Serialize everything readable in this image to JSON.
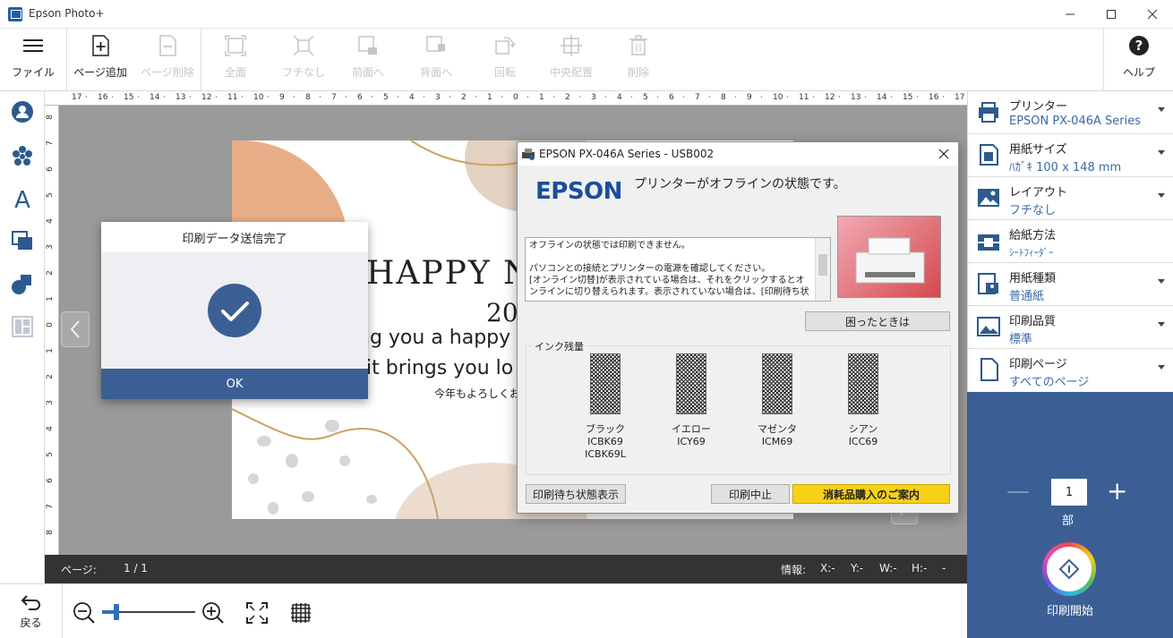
{
  "app": {
    "title": "Epson Photo+"
  },
  "toolbar": {
    "file_label": "ファイル",
    "add_page_label": "ページ追加",
    "delete_page_label": "ページ削除",
    "fit_label": "全面",
    "fill_label": "フチなし",
    "front_label": "前面へ",
    "back_label": "背面へ",
    "rotate_label": "回転",
    "center_label": "中央配置",
    "delete_label": "削除",
    "help_label": "ヘルプ"
  },
  "ruler": {
    "top_ticks": [
      "17",
      "16",
      "15",
      "14",
      "13",
      "12",
      "11",
      "10",
      "9",
      "8",
      "7",
      "6",
      "5",
      "4",
      "3",
      "2",
      "1",
      "0",
      "1",
      "2",
      "3",
      "4",
      "5",
      "6",
      "7",
      "8",
      "9",
      "10",
      "11",
      "12",
      "13",
      "14",
      "15",
      "16",
      "17"
    ],
    "left_ticks": [
      "8",
      "7",
      "6",
      "5",
      "4",
      "3",
      "2",
      "1",
      "0",
      "1",
      "2",
      "3",
      "4",
      "5",
      "6",
      "7",
      "8"
    ]
  },
  "card": {
    "headline": "HAPPY NE",
    "year": "20",
    "line1": "ng you a happy",
    "line2": "it brings you lo",
    "line3": "今年もよろしくお"
  },
  "status": {
    "page_label": "ページ:",
    "page_value": "1 / 1",
    "info_label": "情報:",
    "x": "X:-",
    "y": "Y:-",
    "w": "W:-",
    "h": "H:-",
    "dash": "-"
  },
  "bottom": {
    "back_label": "戻る",
    "zoom_level": 0.15
  },
  "settings": {
    "printer": {
      "label": "プリンター",
      "value": "EPSON PX-046A Series"
    },
    "paper_size": {
      "label": "用紙サイズ",
      "value": "ﾊｶﾞｷ 100 x 148 mm"
    },
    "layout": {
      "label": "レイアウト",
      "value": "フチなし"
    },
    "paper_feed": {
      "label": "給紙方法",
      "value": "ｼｰﾄﾌｨｰﾀﾞｰ"
    },
    "paper_type": {
      "label": "用紙種類",
      "value": "普通紙"
    },
    "quality": {
      "label": "印刷品質",
      "value": "標準"
    },
    "print_pages": {
      "label": "印刷ページ",
      "value": "すべてのページ"
    }
  },
  "print": {
    "copies": "1",
    "copies_unit": "部",
    "start_label": "印刷開始",
    "minus": "—",
    "plus": "+"
  },
  "done_dialog": {
    "title": "印刷データ送信完了",
    "ok_label": "OK"
  },
  "printer_window": {
    "title": "EPSON PX-046A Series - USB002",
    "brand": "EPSON",
    "status_message": "プリンターがオフラインの状態です。",
    "details": [
      "オフラインの状態では印刷できません。",
      "",
      "パソコンとの接続とプリンターの電源を確認してください。",
      "[オンライン切替]が表示されている場合は、それをクリックするとオ",
      "ンラインに切り替えられます。表示されていない場合は、[印刷待ち状"
    ],
    "trouble_button": "困ったときは",
    "ink_group_label": "インク残量",
    "inks": [
      {
        "name": "ブラック",
        "code": "ICBK69",
        "code2": "ICBK69L"
      },
      {
        "name": "イエロー",
        "code": "ICY69",
        "code2": ""
      },
      {
        "name": "マゼンタ",
        "code": "ICM69",
        "code2": ""
      },
      {
        "name": "シアン",
        "code": "ICC69",
        "code2": ""
      }
    ],
    "queue_button": "印刷待ち状態表示",
    "cancel_button": "印刷中止",
    "supplies_button": "消耗品購入のご案内"
  },
  "colors": {
    "accent": "#3b5f95",
    "supplies_yellow": "#f7d117",
    "link_blue": "#3a6aa8"
  }
}
